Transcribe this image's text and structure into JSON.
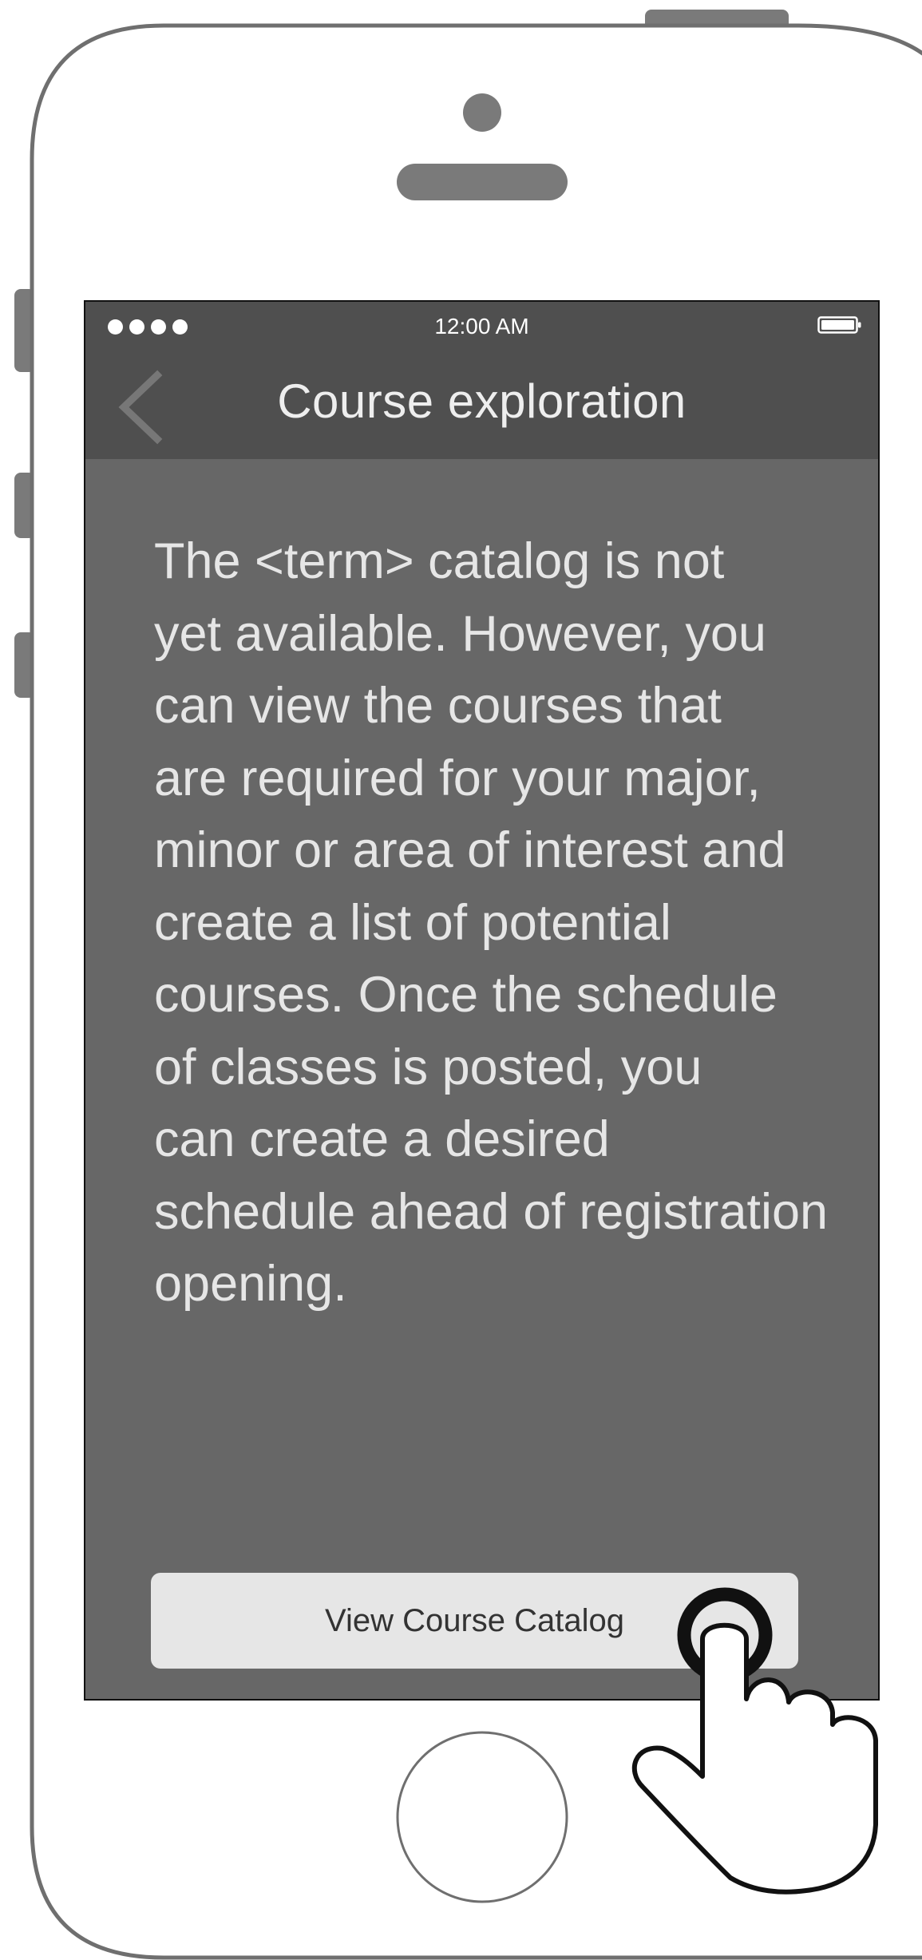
{
  "status_bar": {
    "time": "12:00 AM",
    "signal_icon": "signal-dots-icon",
    "battery_icon": "battery-icon"
  },
  "nav": {
    "title": "Course exploration",
    "back_icon": "chevron-left-icon"
  },
  "content": {
    "message": "The <term> catalog is not\nyet available. However, you\ncan view the courses that\nare required for your major,\nminor or area of interest and\ncreate a list of potential\ncourses. Once the schedule\nof classes is posted, you\ncan create a desired\nschedule ahead of registration\nopening."
  },
  "actions": {
    "catalog_button_label": "View Course Catalog"
  },
  "colors": {
    "screen_background": "#676767",
    "nav_background": "#4f4f4f",
    "button_background": "#e6e6e6",
    "phone_outline": "#6f6f6f"
  }
}
